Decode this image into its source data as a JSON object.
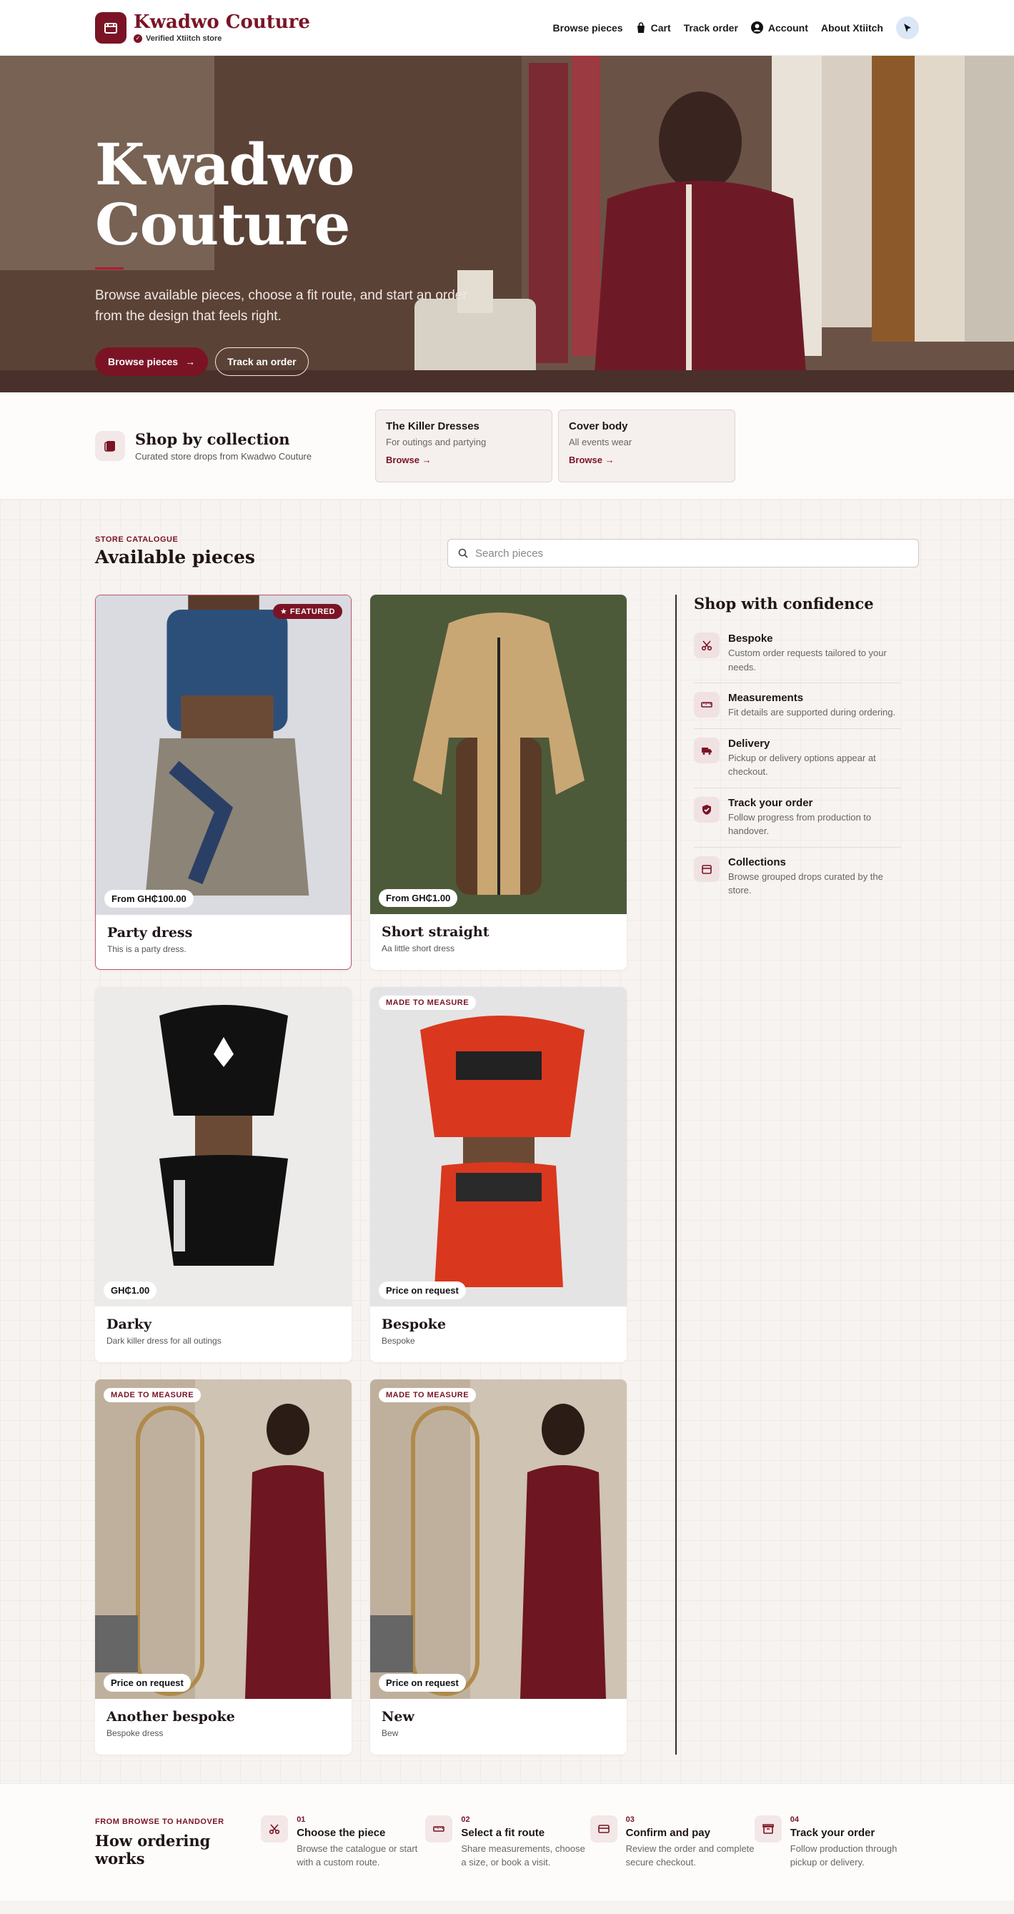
{
  "header": {
    "brand_name": "Kwadwo Couture",
    "verified_label": "Verified Xtiitch store",
    "nav": {
      "browse": "Browse pieces",
      "cart": "Cart",
      "track": "Track order",
      "account": "Account",
      "about": "About Xtiitch"
    }
  },
  "hero": {
    "title": "Kwadwo Couture",
    "subtitle": "Browse available pieces, choose a fit route, and start an order from the design that feels right.",
    "primary_cta": "Browse pieces",
    "secondary_cta": "Track an order"
  },
  "collections": {
    "title": "Shop by collection",
    "subtitle": "Curated store drops from Kwadwo Couture",
    "items": [
      {
        "title": "The Killer Dresses",
        "subtitle": "For outings and partying",
        "link": "Browse"
      },
      {
        "title": "Cover body",
        "subtitle": "All events wear",
        "link": "Browse"
      }
    ]
  },
  "catalogue": {
    "eyebrow": "STORE CATALOGUE",
    "title": "Available pieces",
    "search_placeholder": "Search pieces",
    "featured_label": "FEATURED",
    "made_label": "MADE TO MEASURE",
    "products": [
      {
        "title": "Party dress",
        "desc": "This is a party dress.",
        "price": "From GH₵100.00"
      },
      {
        "title": "Short straight",
        "desc": "Aa little short dress",
        "price": "From GH₵1.00"
      },
      {
        "title": "Darky",
        "desc": "Dark killer dress for all outings",
        "price": "GH₵1.00"
      },
      {
        "title": "Bespoke",
        "desc": "Bespoke",
        "price": "Price on request"
      },
      {
        "title": "Another bespoke",
        "desc": "Bespoke dress",
        "price": "Price on request"
      },
      {
        "title": "New",
        "desc": "Bew",
        "price": "Price on request"
      }
    ]
  },
  "confidence": {
    "title": "Shop with confidence",
    "items": [
      {
        "title": "Bespoke",
        "desc": "Custom order requests tailored to your needs."
      },
      {
        "title": "Measurements",
        "desc": "Fit details are supported during ordering."
      },
      {
        "title": "Delivery",
        "desc": "Pickup or delivery options appear at checkout."
      },
      {
        "title": "Track your order",
        "desc": "Follow progress from production to handover."
      },
      {
        "title": "Collections",
        "desc": "Browse grouped drops curated by the store."
      }
    ]
  },
  "howto": {
    "eyebrow": "FROM BROWSE TO HANDOVER",
    "title": "How ordering works",
    "steps": [
      {
        "num": "01",
        "title": "Choose the piece",
        "desc": "Browse the catalogue or start with a custom route."
      },
      {
        "num": "02",
        "title": "Select a fit route",
        "desc": "Share measurements, choose a size, or book a visit."
      },
      {
        "num": "03",
        "title": "Confirm and pay",
        "desc": "Review the order and complete secure checkout."
      },
      {
        "num": "04",
        "title": "Track your order",
        "desc": "Follow production through pickup or delivery."
      }
    ]
  },
  "colors": {
    "accent": "#7a1425",
    "background": "#f7f3f0"
  }
}
